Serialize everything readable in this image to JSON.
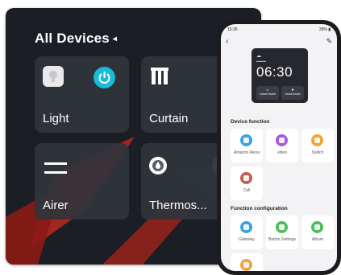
{
  "panel": {
    "title": "All Devices",
    "title_caret": "◂",
    "tiles": [
      {
        "label": "Light",
        "icon": "lightbulb-icon",
        "state": "on"
      },
      {
        "label": "Curtain",
        "icon": "curtain-icon"
      },
      {
        "label": "Airer",
        "icon": "airer-icon"
      },
      {
        "label": "Thermos...",
        "icon": "thermostat-icon"
      }
    ],
    "colors": {
      "power_on": "#18bcd8",
      "accent_red": "#c8281e"
    }
  },
  "phone": {
    "status_time": "15:26",
    "status_right": "39% ▮",
    "back_glyph": "‹",
    "edit_glyph": "✎",
    "preview": {
      "time": "06:30",
      "shortcuts": [
        "Leave Home",
        "Home Arrive"
      ]
    },
    "sections": [
      {
        "title": "Device function",
        "items": [
          {
            "label": "Amazon Alexa",
            "color": "#3aa2e0"
          },
          {
            "label": "video",
            "color": "#a55be0"
          },
          {
            "label": "Switch",
            "color": "#f2a23a"
          },
          {
            "label": "Call",
            "color": "#c0604f"
          }
        ]
      },
      {
        "title": "Function configuration",
        "items": [
          {
            "label": "Gateway",
            "color": "#3aa2e0"
          },
          {
            "label": "Button Settings",
            "color": "#4cbc5c"
          },
          {
            "label": "Album",
            "color": "#4cbc5c"
          },
          {
            "label": "",
            "color": "#f2a23a"
          }
        ]
      }
    ]
  }
}
